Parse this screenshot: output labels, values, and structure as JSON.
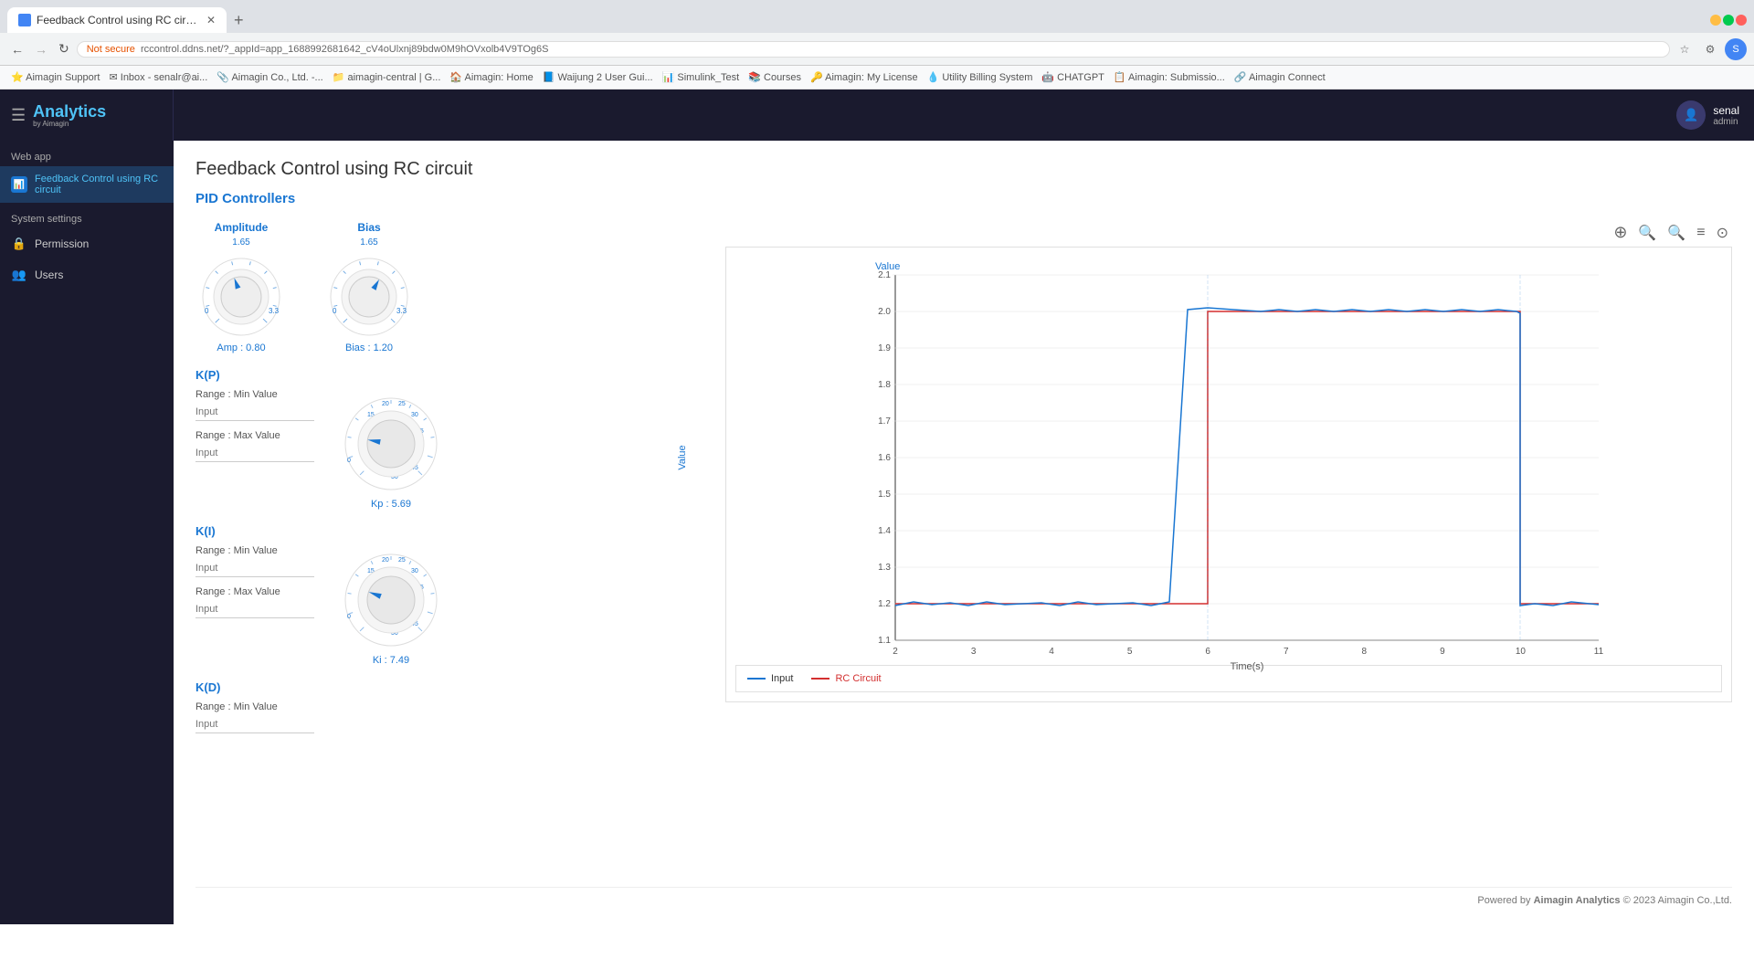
{
  "browser": {
    "tab_title": "Feedback Control using RC circu...",
    "tab_new": "+",
    "address": "rccontrol.ddns.net/?_appId=app_1688992681642_cV4oUlxnj89bdw0M9hOVxolb4V9TOg6S",
    "not_secure": "Not secure",
    "nav_back": "←",
    "nav_forward": "→",
    "nav_refresh": "↻"
  },
  "bookmarks": [
    {
      "label": "Aimagin Support"
    },
    {
      "label": "Inbox - senalr@ai..."
    },
    {
      "label": "Aimagin Co., Ltd. -..."
    },
    {
      "label": "aimagin-central | G..."
    },
    {
      "label": "Aimagin: Home"
    },
    {
      "label": "Waijung 2 User Gui..."
    },
    {
      "label": "Simulink_Test"
    },
    {
      "label": "Courses"
    },
    {
      "label": "Aimagin: My License"
    },
    {
      "label": "Utility Billing System"
    },
    {
      "label": "CHATGPT"
    },
    {
      "label": "Aimagin: Submissio..."
    },
    {
      "label": "Aimagin Connect"
    }
  ],
  "app": {
    "logo": "Analytics",
    "logo_sub": "by Aimagin",
    "hamburger": "☰"
  },
  "sidebar": {
    "section_webapp": "Web app",
    "item_feedback": "Feedback Control using RC circuit",
    "section_settings": "System settings",
    "item_permission": "Permission",
    "item_users": "Users"
  },
  "user": {
    "name": "senal",
    "role": "admin"
  },
  "page": {
    "title": "Feedback Control using RC circuit",
    "subtitle": "PID Controllers"
  },
  "amplitude": {
    "label": "Amplitude",
    "value_top": "1.65",
    "value_bottom": "Amp : 0.80"
  },
  "bias": {
    "label": "Bias",
    "value_top": "1.65",
    "value_bottom": "Bias : 1.20"
  },
  "kp": {
    "label": "K(P)",
    "range_min_label": "Range : Min Value",
    "range_max_label": "Range : Max Value",
    "input_placeholder": "Input",
    "knob_value": "Kp : 5.69",
    "value_top": "10 15 20 25 30 35 40",
    "knob_min": "0",
    "knob_max": "50"
  },
  "ki": {
    "label": "K(I)",
    "range_min_label": "Range : Min Value",
    "range_max_label": "Range : Max Value",
    "input_placeholder": "Input",
    "knob_value": "Ki : 7.49"
  },
  "kd": {
    "label": "K(D)",
    "range_min_label": "Range : Min Value"
  },
  "chart": {
    "y_label": "Value",
    "x_label": "Time(s)",
    "y_min": "1.1",
    "y_max": "2.1",
    "x_min": "2",
    "x_max": "11",
    "legend_input": "Input",
    "legend_rc": "RC Circuit",
    "input_color": "#1976d2",
    "rc_color": "#d32f2f"
  },
  "chart_tools": {
    "move": "⊕",
    "zoom_in": "🔍",
    "zoom_out": "🔍",
    "list": "≡",
    "settings": "⊙"
  },
  "footer": {
    "text": "Powered by Aimagin Analytics © 2023 Aimagin Co.,Ltd."
  }
}
